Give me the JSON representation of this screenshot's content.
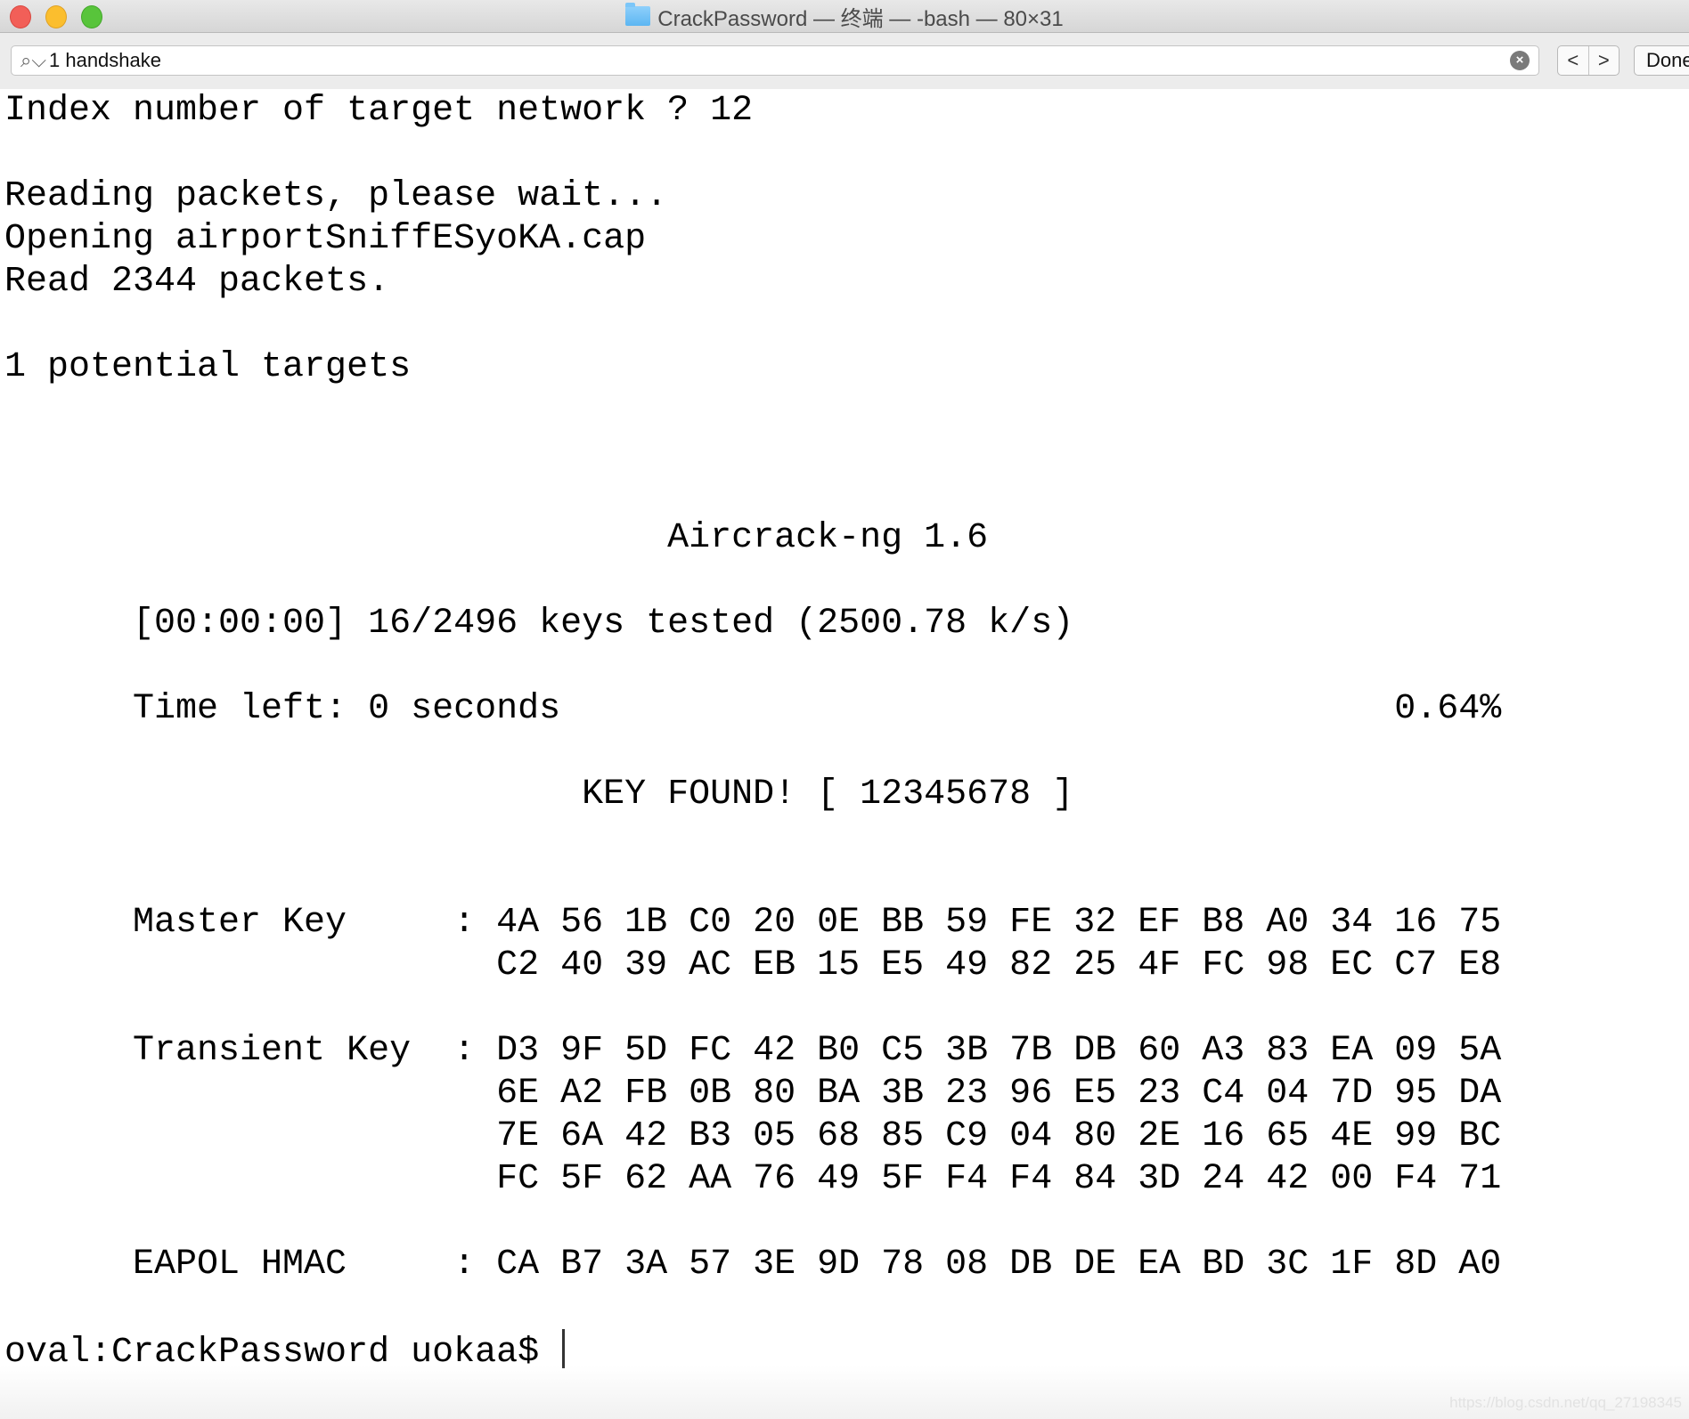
{
  "window": {
    "title": "CrackPassword — 终端 — -bash — 80×31",
    "folder_icon": "folder-icon"
  },
  "find_bar": {
    "value": "1 handshake",
    "prev_label": "<",
    "next_label": ">",
    "done_label": "Done"
  },
  "terminal": {
    "lines": [
      "Index number of target network ? 12",
      "",
      "Reading packets, please wait...",
      "Opening airportSniffESyoKA.cap",
      "Read 2344 packets.",
      "",
      "1 potential targets",
      "",
      "",
      "",
      "                               Aircrack-ng 1.6",
      "",
      "      [00:00:00] 16/2496 keys tested (2500.78 k/s)",
      "",
      "      Time left: 0 seconds                                       0.64%",
      "",
      "                           KEY FOUND! [ 12345678 ]",
      "",
      "",
      "      Master Key     : 4A 56 1B C0 20 0E BB 59 FE 32 EF B8 A0 34 16 75",
      "                       C2 40 39 AC EB 15 E5 49 82 25 4F FC 98 EC C7 E8",
      "",
      "      Transient Key  : D3 9F 5D FC 42 B0 C5 3B 7B DB 60 A3 83 EA 09 5A",
      "                       6E A2 FB 0B 80 BA 3B 23 96 E5 23 C4 04 7D 95 DA",
      "                       7E 6A 42 B3 05 68 85 C9 04 80 2E 16 65 4E 99 BC",
      "                       FC 5F 62 AA 76 49 5F F4 F4 84 3D 24 42 00 F4 71",
      "",
      "      EAPOL HMAC     : CA B7 3A 57 3E 9D 78 08 DB DE EA BD 3C 1F 8D A0",
      "",
      ""
    ],
    "prompt": "oval:CrackPassword uokaa$ "
  },
  "watermark": "https://blog.csdn.net/qq_27198345"
}
